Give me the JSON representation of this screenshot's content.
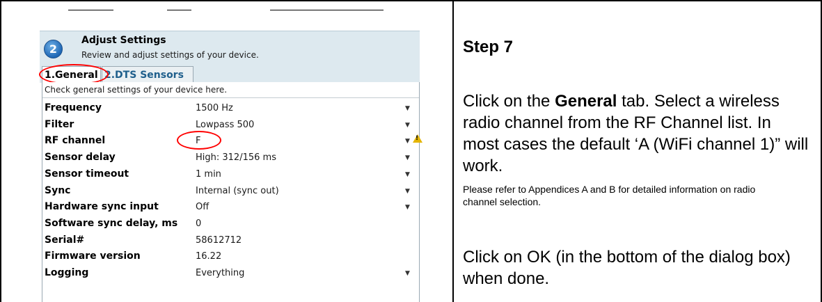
{
  "dialog": {
    "step_number": "2",
    "title": "Adjust Settings",
    "subtitle": "Review and adjust settings of your device.",
    "tabs": [
      {
        "label": "1.General",
        "active": true
      },
      {
        "label": "2.DTS Sensors",
        "active": false
      }
    ],
    "description": "Check general settings of your device here.",
    "properties": [
      {
        "label": "Frequency",
        "value": "1500 Hz",
        "dropdown": true
      },
      {
        "label": "Filter",
        "value": "Lowpass 500",
        "dropdown": true
      },
      {
        "label": "RF channel",
        "value": "F",
        "dropdown": true,
        "warning": true
      },
      {
        "label": "Sensor delay",
        "value": "High: 312/156 ms",
        "dropdown": true
      },
      {
        "label": "Sensor timeout",
        "value": "1 min",
        "dropdown": true
      },
      {
        "label": "Sync",
        "value": "Internal (sync out)",
        "dropdown": true
      },
      {
        "label": "Hardware sync input",
        "value": "Off",
        "dropdown": true
      },
      {
        "label": "Software sync delay, ms",
        "value": "0",
        "dropdown": false
      },
      {
        "label": "Serial#",
        "value": "58612712",
        "dropdown": false
      },
      {
        "label": "Firmware version",
        "value": "16.22",
        "dropdown": false
      },
      {
        "label": "Logging",
        "value": "Everything",
        "dropdown": true
      }
    ],
    "colors": {
      "header_bg": "#dde9ef",
      "highlight": "#ff0000",
      "warning": "#e4b400"
    }
  },
  "instructions": {
    "step_title": "Step 7",
    "p1_before": "Click on the ",
    "p1_bold": "General",
    "p1_after": " tab. Select a wireless radio channel from the RF Channel list. In most cases the default ‘A (WiFi channel 1)” will work.",
    "p2": "Please refer to Appendices A and B for detailed information on radio channel selection.",
    "p3": "Click on OK (in the bottom of the dialog box) when done."
  }
}
